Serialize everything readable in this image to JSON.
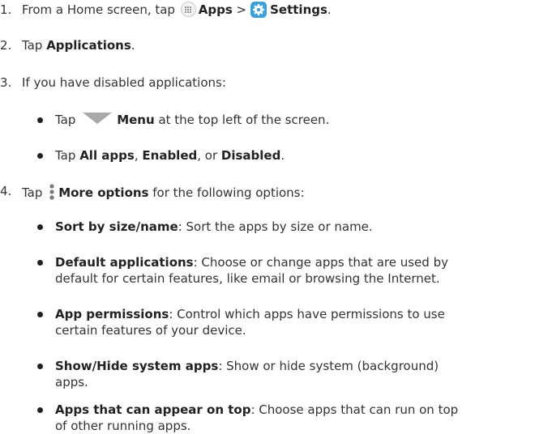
{
  "steps": {
    "s1": {
      "num": "1.",
      "pre": "From a Home screen, tap",
      "apps": "Apps",
      "sep": ">",
      "settings": "Settings",
      "end": "."
    },
    "s2": {
      "num": "2.",
      "pre": "Tap",
      "b": "Applications",
      "end": "."
    },
    "s3": {
      "num": "3.",
      "text": "If you have disabled applications:"
    },
    "s3a": {
      "pre": "Tap",
      "b": "Menu",
      "post": "at the top left of the screen."
    },
    "s3b": {
      "pre": "Tap",
      "b1": "All apps",
      "m1": ",",
      "b2": "Enabled",
      "m2": ", or",
      "b3": "Disabled",
      "end": "."
    },
    "s4": {
      "num": "4.",
      "pre": "Tap",
      "b": "More options",
      "post": "for the following options:"
    },
    "o1": {
      "b": "Sort by size/name",
      "text": ": Sort the apps by size or name."
    },
    "o2": {
      "b": "Default applications",
      "text1": ": Choose or change apps that are used by",
      "text2": "default for certain features, like email or browsing the Internet."
    },
    "o3": {
      "b": "App permissions",
      "text1": ": Control which apps have permissions to use",
      "text2": "certain features of your device."
    },
    "o4": {
      "b": "Show/Hide system apps",
      "text1": ": Show or hide system (background)",
      "text2": "apps."
    },
    "o5": {
      "b": "Apps that can appear on top",
      "text1": ": Choose apps that can run on top",
      "text2": "of other running apps."
    }
  },
  "icons": {
    "apps": "apps-grid-icon",
    "settings": "settings-gear-icon",
    "menu": "menu-triangle-icon",
    "more": "more-options-icon"
  },
  "colors": {
    "text": "#333333",
    "bold": "#222222",
    "settings_icon": "#3aa0dd",
    "menu_icon": "#a9a9a9"
  }
}
